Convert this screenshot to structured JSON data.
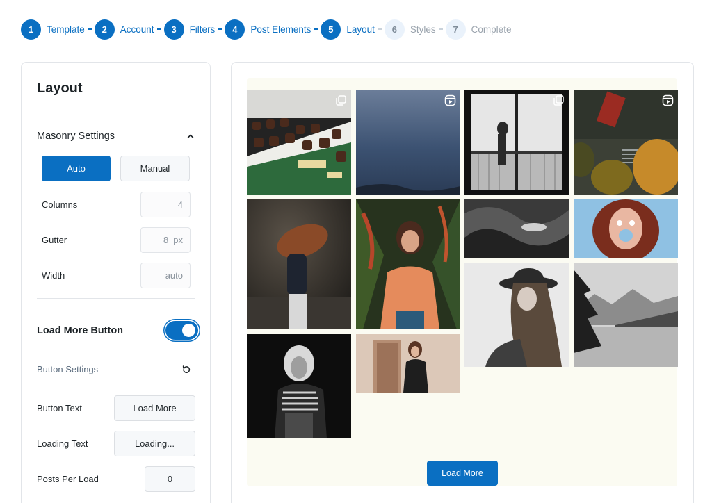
{
  "stepper": [
    {
      "num": "1",
      "label": "Template",
      "state": "done"
    },
    {
      "num": "2",
      "label": "Account",
      "state": "done"
    },
    {
      "num": "3",
      "label": "Filters",
      "state": "done"
    },
    {
      "num": "4",
      "label": "Post Elements",
      "state": "done"
    },
    {
      "num": "5",
      "label": "Layout",
      "state": "current"
    },
    {
      "num": "6",
      "label": "Styles",
      "state": "todo"
    },
    {
      "num": "7",
      "label": "Complete",
      "state": "todo"
    }
  ],
  "panel": {
    "title": "Layout",
    "masonry": {
      "title": "Masonry Settings",
      "auto_label": "Auto",
      "manual_label": "Manual",
      "selected": "Auto",
      "columns_label": "Columns",
      "columns_value": "4",
      "gutter_label": "Gutter",
      "gutter_value": "8",
      "gutter_unit": "px",
      "width_label": "Width",
      "width_value": "auto"
    },
    "load_more": {
      "title": "Load More Button",
      "enabled": true,
      "settings_title": "Button Settings",
      "button_text_label": "Button Text",
      "button_text_value": "Load More",
      "loading_text_label": "Loading Text",
      "loading_text_value": "Loading...",
      "posts_per_load_label": "Posts Per Load",
      "posts_per_load_value": "0"
    }
  },
  "preview": {
    "load_more_label": "Load More",
    "tiles": [
      {
        "name": "chocolate-pastries-photo",
        "icon": "gallery-icon"
      },
      {
        "name": "lake-water-photo",
        "icon": "reel-icon"
      },
      {
        "name": "window-silhouette-photo",
        "icon": "gallery-icon"
      },
      {
        "name": "aerial-tram-street-photo",
        "icon": "reel-icon"
      },
      {
        "name": "hair-flip-woman-photo",
        "icon": ""
      },
      {
        "name": "woman-orange-shirt-photo",
        "icon": ""
      },
      {
        "name": "rocky-coast-photo",
        "icon": ""
      },
      {
        "name": "curly-hair-woman-photo",
        "icon": ""
      },
      {
        "name": "woman-hat-photo",
        "icon": ""
      },
      {
        "name": "mountain-lake-photo",
        "icon": ""
      },
      {
        "name": "blonde-woman-striped-photo",
        "icon": ""
      },
      {
        "name": "woman-doorway-photo",
        "icon": ""
      }
    ]
  }
}
